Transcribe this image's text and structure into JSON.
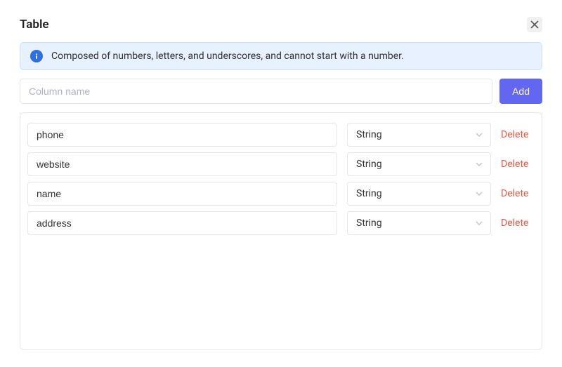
{
  "header": {
    "title": "Table"
  },
  "alert": {
    "message": "Composed of numbers, letters, and underscores, and cannot start with a number."
  },
  "input_row": {
    "placeholder": "Column name",
    "value": "",
    "add_label": "Add"
  },
  "columns": [
    {
      "name": "phone",
      "type": "String",
      "delete_label": "Delete"
    },
    {
      "name": "website",
      "type": "String",
      "delete_label": "Delete"
    },
    {
      "name": "name",
      "type": "String",
      "delete_label": "Delete"
    },
    {
      "name": "address",
      "type": "String",
      "delete_label": "Delete"
    }
  ]
}
